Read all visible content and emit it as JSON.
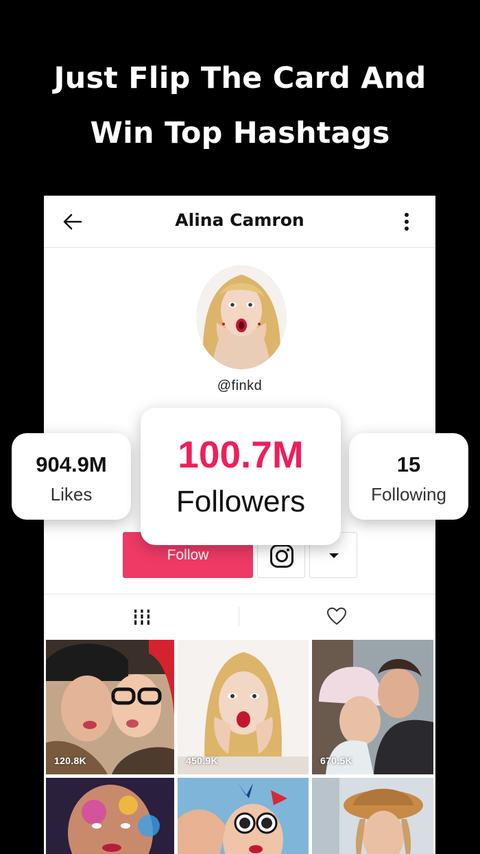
{
  "headline": {
    "line1": "Just Flip The Card And",
    "line2": "Win Top Hashtags"
  },
  "profile": {
    "title": "Alina Camron",
    "handle": "@finkd",
    "follow_label": "Follow"
  },
  "stats": {
    "likes": {
      "value": "904.9M",
      "label": "Likes"
    },
    "followers": {
      "value": "100.7M",
      "label": "Followers"
    },
    "following": {
      "value": "15",
      "label": "Following"
    }
  },
  "grid": {
    "counts": [
      "120.8K",
      "450.9K",
      "670.5K"
    ]
  },
  "colors": {
    "accent": "#ee1f5a",
    "follow_button": "#ee2a5a",
    "background": "#000000"
  },
  "icons": {
    "back": "arrow-left-icon",
    "more": "more-vertical-icon",
    "instagram": "instagram-icon",
    "dropdown": "caret-down-icon",
    "grid_tab": "grid-icon",
    "likes_tab": "heart-icon"
  }
}
